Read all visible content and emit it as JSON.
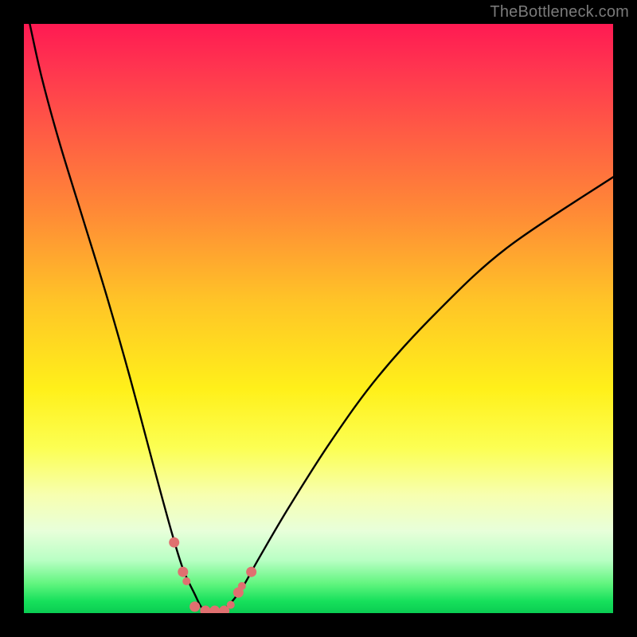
{
  "watermark": "TheBottleneck.com",
  "colors": {
    "curve": "#000000",
    "marker_fill": "#e07070",
    "marker_stroke": "#b84b4b",
    "background_border": "#000000"
  },
  "chart_data": {
    "type": "line",
    "title": "",
    "xlabel": "",
    "ylabel": "",
    "xlim": [
      0,
      100
    ],
    "ylim": [
      0,
      100
    ],
    "note": "Bottleneck curve: two asymmetric branches meeting at a minimum near x≈31–34 where y≈0 (green zone). Left branch rises sharply to y=100 as x→0; right branch rises more gently toward y≈74 at x=100. Values are approximate, read from pixel positions; chart has no tick labels.",
    "series": [
      {
        "name": "bottleneck-curve",
        "x": [
          1,
          3,
          6,
          10,
          14,
          18,
          22,
          25,
          27,
          29,
          30,
          31,
          33,
          34,
          35,
          37,
          40,
          45,
          52,
          60,
          70,
          82,
          100
        ],
        "y": [
          100,
          91,
          80,
          67,
          54,
          40,
          25,
          14,
          7.5,
          3.2,
          1.2,
          0.3,
          0.3,
          0.7,
          1.6,
          4.2,
          9.5,
          18,
          29,
          40,
          51,
          62,
          74
        ]
      }
    ],
    "markers": {
      "name": "highlight-points",
      "x": [
        25.5,
        27.0,
        27.6,
        29.0,
        30.8,
        32.4,
        34.0,
        35.1,
        36.4,
        37.0,
        38.6
      ],
      "y": [
        12.0,
        7.0,
        5.4,
        1.1,
        0.4,
        0.4,
        0.4,
        1.4,
        3.5,
        4.6,
        7.0
      ],
      "r": [
        6.5,
        6.5,
        5.0,
        6.5,
        6.5,
        6.5,
        6.5,
        5.0,
        6.5,
        5.0,
        6.5
      ]
    }
  }
}
